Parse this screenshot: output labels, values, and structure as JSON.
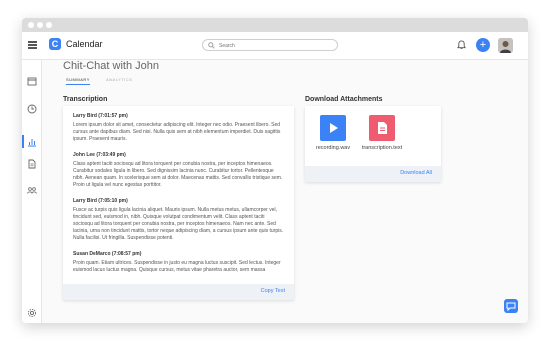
{
  "app": {
    "name": "Calendar",
    "logo_letter": "C"
  },
  "search": {
    "placeholder": "Search"
  },
  "page": {
    "title": "Chit-Chat with John"
  },
  "tabs": [
    {
      "label": "SUMMARY",
      "active": true
    },
    {
      "label": "ANALYTICS",
      "active": false
    }
  ],
  "transcription": {
    "title": "Transcription",
    "copy_label": "Copy Text",
    "entries": [
      {
        "speaker": "Larry Bird (7:01:57 pm)",
        "text": "Lorem ipsum dolor sit amet, consectetur adipiscing elit. Integer nec odio. Praesent libero. Sed cursus ante dapibus diam. Sed nisi. Nulla quis sem at nibh elementum imperdiet. Duis sagittis ipsum. Praesent mauris."
      },
      {
        "speaker": "John Lee (7:03:49 pm)",
        "text": "Class aptent taciti sociosqu ad litora torquent per conubia nostra, per inceptos himenaeos. Curabitur sodales ligula in libero. Sed dignissim lacinia nunc. Curabitur tortor. Pellentesque nibh. Aenean quam. In scelerisque sem at dolor. Maecenas mattis. Sed convallis tristique sem. Proin ut ligula vel nunc egestas porttitor."
      },
      {
        "speaker": "Larry Bird (7:05:10 pm)",
        "text": "Fusce ac turpis quis ligula lacinia aliquet. Mauris ipsum. Nulla metus metus, ullamcorper vel, tincidunt sed, euismod in, nibh. Quisque volutpat condimentum velit. Class aptent taciti sociosqu ad litora torquent per conubia nostra, per inceptos himenaeos. Nam nec ante. Sed lacinia, urna non tincidunt mattis, tortor neque adipiscing diam, a cursus ipsum ante quis turpis. Nulla facilisi. Ut fringilla. Suspendisse potenti."
      },
      {
        "speaker": "Susan DeMarco (7:08:57 pm)",
        "text": "Proin quam. Etiam ultrices. Suspendisse in justo eu magna luctus suscipit. Sed lectus. Integer euismod lacus luctus magna. Quisque cursus, metus vitae pharetra auctor, sem massa"
      }
    ]
  },
  "attachments": {
    "title": "Download Attachments",
    "download_all_label": "Download All",
    "files": [
      {
        "name": "recording.wav",
        "icon": "play-icon",
        "color": "#3b82f6"
      },
      {
        "name": "transcription.text",
        "icon": "document-icon",
        "color": "#ef5b6f"
      }
    ]
  },
  "colors": {
    "accent": "#3b82f6",
    "text_file": "#ef5b6f",
    "titlebar": "#dcdcdc"
  }
}
